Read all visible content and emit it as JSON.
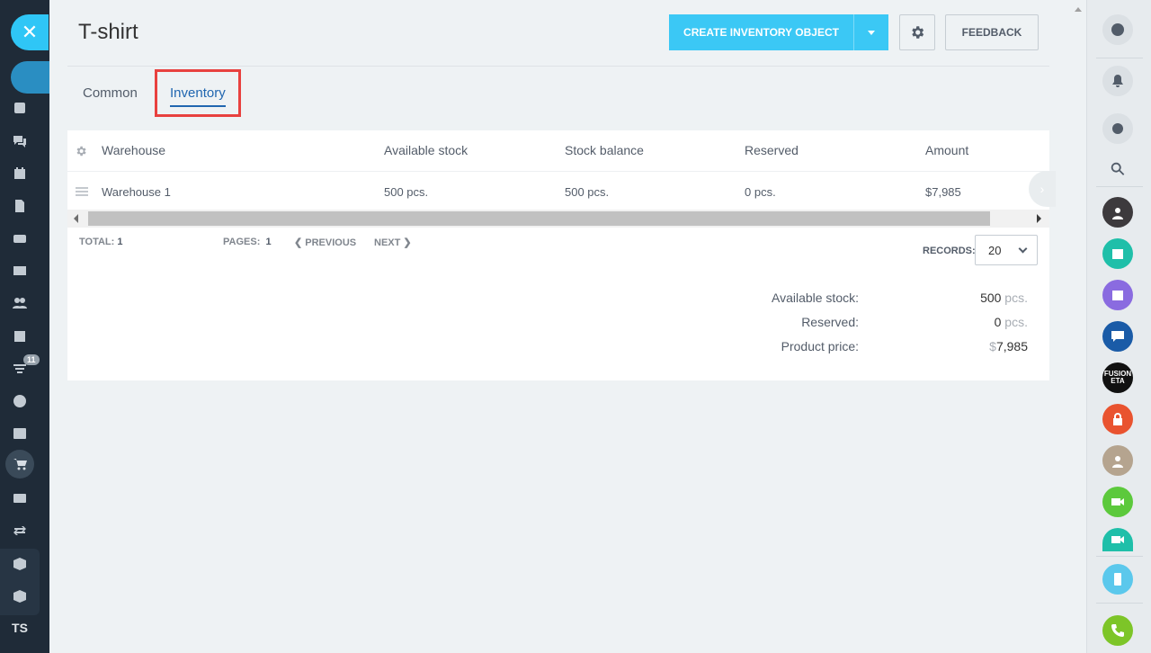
{
  "page": {
    "title": "T-shirt"
  },
  "toolbar": {
    "create_label": "CREATE INVENTORY OBJECT",
    "feedback_label": "FEEDBACK"
  },
  "tabs": [
    {
      "label": "Common",
      "active": false
    },
    {
      "label": "Inventory",
      "active": true
    }
  ],
  "table": {
    "columns": [
      "Warehouse",
      "Available stock",
      "Stock balance",
      "Reserved",
      "Amount"
    ],
    "rows": [
      {
        "warehouse": "Warehouse 1",
        "available": "500 pcs.",
        "balance": "500 pcs.",
        "reserved": "0 pcs.",
        "amount": "$7,985"
      }
    ]
  },
  "pager": {
    "total_label": "TOTAL:",
    "total_value": "1",
    "pages_label": "PAGES:",
    "pages_value": "1",
    "previous_label": "PREVIOUS",
    "next_label": "NEXT",
    "records_label": "RECORDS:",
    "records_value": "20"
  },
  "summary": {
    "available_label": "Available stock:",
    "available_value": "500",
    "available_unit": " pcs.",
    "reserved_label": "Reserved:",
    "reserved_value": "0",
    "reserved_unit": " pcs.",
    "price_label": "Product price:",
    "price_currency": "$",
    "price_value": "7,985"
  },
  "sidebar": {
    "notification_count": "11",
    "user_initials": "TS"
  },
  "right_sidebar": {
    "fusion_avatar_text": "FUSION ETA"
  },
  "colors": {
    "accent": "#3bc8f5",
    "sidebar_bg": "#1f2b38",
    "tab_active": "#2066b0",
    "highlight": "#e8413f"
  }
}
